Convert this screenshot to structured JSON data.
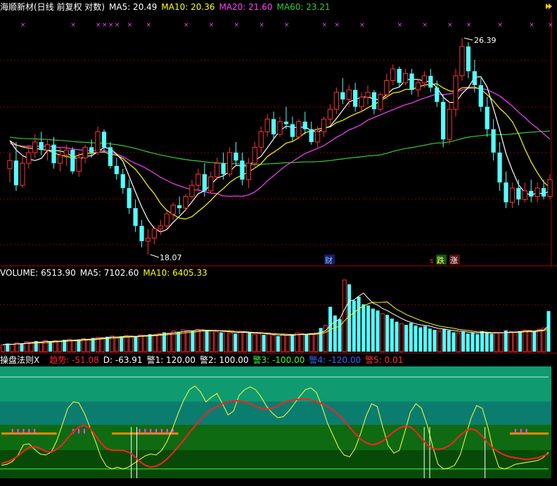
{
  "price_header": {
    "title": "海顺新材(日线 前复权 对数)",
    "ma5": "MA5: 20.49",
    "ma10": "MA10: 20.36",
    "ma20": "MA20: 21.60",
    "ma60": "MA60: 23.21"
  },
  "price_panel": {
    "high_label": "26.39",
    "low_label": "18.07",
    "marker_cai": "财",
    "marker_die": "跌",
    "marker_zhang": "涨",
    "marker_s": "s"
  },
  "vol_header": {
    "title": "VOLUME: 6513.90",
    "ma5": "MA5: 7102.60",
    "ma10": "MA10: 6405.33"
  },
  "ind_header": {
    "title": "操盘法则X",
    "trend": "趋势: -51.08",
    "d": "D: -63.91",
    "warn1": "警1: 120.00",
    "warn2": "警2: 100.00",
    "warn3": "警3: -100.00",
    "warn4": "警4: -120.00",
    "warn5": "警5: 0.01"
  },
  "colors": {
    "up": "#ff3333",
    "down": "#54ffff",
    "ma5": "#ffffff",
    "ma10": "#ffff00",
    "ma20": "#ff40ff",
    "ma60": "#33cc33",
    "trend": "#ff2020",
    "d_line": "#ffff40",
    "grid": "#8b0000"
  },
  "chart_data": [
    {
      "type": "candlestick",
      "title": "海顺新材(日线 前复权 对数)",
      "annotations": [
        {
          "text": "26.39",
          "kind": "high"
        },
        {
          "text": "18.07",
          "kind": "low"
        }
      ],
      "ohlc": [
        [
          21.0,
          21.6,
          20.5,
          21.3
        ],
        [
          21.3,
          22.0,
          20.2,
          20.4
        ],
        [
          20.4,
          21.5,
          20.3,
          21.2
        ],
        [
          21.2,
          21.9,
          21.0,
          21.6
        ],
        [
          21.6,
          22.3,
          21.4,
          22.0
        ],
        [
          22.0,
          22.4,
          21.5,
          21.7
        ],
        [
          21.7,
          22.1,
          21.3,
          21.9
        ],
        [
          21.9,
          22.2,
          21.0,
          21.2
        ],
        [
          21.2,
          21.8,
          20.9,
          21.5
        ],
        [
          21.5,
          21.9,
          21.1,
          21.7
        ],
        [
          21.7,
          21.8,
          20.8,
          20.9
        ],
        [
          20.9,
          21.6,
          20.7,
          21.4
        ],
        [
          21.4,
          21.9,
          21.2,
          21.8
        ],
        [
          21.8,
          22.1,
          21.4,
          21.6
        ],
        [
          21.6,
          22.6,
          21.5,
          22.4
        ],
        [
          22.4,
          22.5,
          21.6,
          21.8
        ],
        [
          21.8,
          22.0,
          21.0,
          21.1
        ],
        [
          21.1,
          21.4,
          20.6,
          20.8
        ],
        [
          20.8,
          21.0,
          20.1,
          20.3
        ],
        [
          20.3,
          20.6,
          19.4,
          19.6
        ],
        [
          19.6,
          19.9,
          18.8,
          19.0
        ],
        [
          19.0,
          19.2,
          18.3,
          18.5
        ],
        [
          18.5,
          18.9,
          18.07,
          18.6
        ],
        [
          18.6,
          19.0,
          18.4,
          18.9
        ],
        [
          18.9,
          19.2,
          18.7,
          19.0
        ],
        [
          19.0,
          19.5,
          18.9,
          19.4
        ],
        [
          19.4,
          19.8,
          19.2,
          19.7
        ],
        [
          19.7,
          20.0,
          19.4,
          19.6
        ],
        [
          19.6,
          20.1,
          19.5,
          20.0
        ],
        [
          20.0,
          20.6,
          19.9,
          20.4
        ],
        [
          20.4,
          21.0,
          20.2,
          20.8
        ],
        [
          20.8,
          21.2,
          20.0,
          20.2
        ],
        [
          20.2,
          20.9,
          20.1,
          20.7
        ],
        [
          20.7,
          21.4,
          20.6,
          21.2
        ],
        [
          21.2,
          21.6,
          20.6,
          20.8
        ],
        [
          20.8,
          21.8,
          20.7,
          21.6
        ],
        [
          21.6,
          22.0,
          21.1,
          21.3
        ],
        [
          21.3,
          21.6,
          20.4,
          20.6
        ],
        [
          20.6,
          21.4,
          20.3,
          21.2
        ],
        [
          21.2,
          22.0,
          21.0,
          21.8
        ],
        [
          21.8,
          22.6,
          21.6,
          22.4
        ],
        [
          22.4,
          23.1,
          22.2,
          22.9
        ],
        [
          22.9,
          23.2,
          22.1,
          22.3
        ],
        [
          22.3,
          23.0,
          22.2,
          22.8
        ],
        [
          22.8,
          23.4,
          22.5,
          22.7
        ],
        [
          22.7,
          23.0,
          22.0,
          22.2
        ],
        [
          22.2,
          22.9,
          22.1,
          22.8
        ],
        [
          22.8,
          23.2,
          22.3,
          22.5
        ],
        [
          22.5,
          22.8,
          21.9,
          22.0
        ],
        [
          22.0,
          22.6,
          21.8,
          22.4
        ],
        [
          22.4,
          23.0,
          22.2,
          22.9
        ],
        [
          22.9,
          23.5,
          22.7,
          23.3
        ],
        [
          23.3,
          24.2,
          23.1,
          24.0
        ],
        [
          24.0,
          24.6,
          23.5,
          23.7
        ],
        [
          23.7,
          24.3,
          23.4,
          24.1
        ],
        [
          24.1,
          24.4,
          23.2,
          23.4
        ],
        [
          23.4,
          24.0,
          23.2,
          23.8
        ],
        [
          23.8,
          24.3,
          23.5,
          24.0
        ],
        [
          24.0,
          24.1,
          23.1,
          23.3
        ],
        [
          23.3,
          24.0,
          23.2,
          23.9
        ],
        [
          23.9,
          24.8,
          23.7,
          24.5
        ],
        [
          24.5,
          25.2,
          24.3,
          25.0
        ],
        [
          25.0,
          25.1,
          24.2,
          24.4
        ],
        [
          24.4,
          25.0,
          24.3,
          24.8
        ],
        [
          24.8,
          25.0,
          23.9,
          24.1
        ],
        [
          24.1,
          24.6,
          23.8,
          24.4
        ],
        [
          24.4,
          24.9,
          24.2,
          24.7
        ],
        [
          24.7,
          25.0,
          24.0,
          24.2
        ],
        [
          24.2,
          24.5,
          23.4,
          23.6
        ],
        [
          23.6,
          23.9,
          21.8,
          22.1
        ],
        [
          22.1,
          23.6,
          21.9,
          23.3
        ],
        [
          23.3,
          25.0,
          23.0,
          24.7
        ],
        [
          24.7,
          26.39,
          24.5,
          26.0
        ],
        [
          26.0,
          26.2,
          24.6,
          24.9
        ],
        [
          24.9,
          25.4,
          24.0,
          24.3
        ],
        [
          24.3,
          24.6,
          23.2,
          23.4
        ],
        [
          23.4,
          23.8,
          22.2,
          22.5
        ],
        [
          22.5,
          22.9,
          21.3,
          21.6
        ],
        [
          21.6,
          22.0,
          20.2,
          20.5
        ],
        [
          20.5,
          20.9,
          19.6,
          19.8
        ],
        [
          19.8,
          20.5,
          19.6,
          20.3
        ],
        [
          20.3,
          20.6,
          19.7,
          19.9
        ],
        [
          19.9,
          20.5,
          19.8,
          20.2
        ],
        [
          20.2,
          20.6,
          19.8,
          20.0
        ],
        [
          20.0,
          20.5,
          19.8,
          20.3
        ],
        [
          20.3,
          20.6,
          19.9,
          20.0
        ],
        [
          20.0,
          20.8,
          19.9,
          20.6
        ]
      ],
      "ma_values": {
        "MA5": 20.49,
        "MA10": 20.36,
        "MA20": 21.6,
        "MA60": 23.21
      }
    },
    {
      "type": "bar",
      "title": "VOLUME",
      "values": [
        1100,
        1300,
        1150,
        1400,
        1350,
        1600,
        1550,
        1700,
        1500,
        1800,
        1650,
        1750,
        1700,
        1900,
        2000,
        1850,
        1950,
        2100,
        2000,
        2200,
        2300,
        2250,
        2400,
        2500,
        2350,
        2450,
        2600,
        2500,
        2400,
        2700,
        2600,
        2800,
        2750,
        2900,
        3100,
        3000,
        3300,
        3200,
        3500,
        3400,
        3300,
        3600,
        3500,
        3400,
        3300,
        3200,
        3100,
        3300,
        3000,
        2900,
        3100,
        3200,
        3000,
        2800,
        2900,
        2700,
        2800,
        2600,
        2500,
        2700,
        2600,
        2800,
        3000,
        2900,
        2800,
        2900,
        3000,
        3800,
        4200,
        7200,
        5800,
        5200,
        11500,
        10800,
        8200,
        8800,
        7600,
        7400,
        6900,
        6600,
        6100,
        5900,
        5300,
        4800,
        4500,
        4300,
        4600,
        4200,
        3900,
        4100,
        3700,
        3500,
        3300,
        3600,
        3400,
        3100,
        3000,
        3200,
        2900,
        3100,
        2800,
        3300,
        3000,
        2900,
        3100,
        3000,
        3400,
        3200,
        3100,
        3300,
        3500,
        3400,
        3200,
        3600,
        3800,
        6513.9
      ],
      "ma5": 7102.6,
      "ma10": 6405.33
    },
    {
      "type": "line",
      "title": "操盘法则X",
      "series": [
        {
          "name": "趋势",
          "values": [
            -88,
            -85,
            -80,
            -72,
            -62,
            -54,
            -52,
            -56,
            -62,
            -64,
            -58,
            -48,
            -34,
            -20,
            -10,
            -6,
            -12,
            -28,
            -44,
            -56,
            -60,
            -60,
            -60,
            -64,
            -72,
            -84,
            -92,
            -96,
            -94,
            -88,
            -78,
            -66,
            -52,
            -38,
            -22,
            -8,
            6,
            18,
            28,
            34,
            40,
            44,
            46,
            46,
            44,
            40,
            34,
            30,
            28,
            30,
            36,
            42,
            46,
            48,
            50,
            50,
            48,
            44,
            40,
            34,
            26,
            16,
            4,
            -10,
            -24,
            -36,
            -44,
            -48,
            -46,
            -40,
            -30,
            -20,
            -12,
            -8,
            -10,
            -20,
            -34,
            -48,
            -56,
            -58,
            -56,
            -50,
            -40,
            -28,
            -18,
            -14,
            -18,
            -30,
            -44,
            -56,
            -64,
            -70,
            -74,
            -76,
            -78,
            -80,
            -78,
            -76,
            -72,
            -68
          ]
        },
        {
          "name": "D",
          "values": [
            -92,
            -90,
            -84,
            -70,
            -48,
            -46,
            -58,
            -68,
            -70,
            -64,
            -40,
            -6,
            30,
            44,
            42,
            20,
            -10,
            -40,
            -74,
            -94,
            -100,
            -96,
            -100,
            -96,
            -88,
            -80,
            -72,
            -68,
            -70,
            -60,
            -40,
            -12,
            20,
            48,
            70,
            78,
            66,
            44,
            54,
            62,
            40,
            16,
            24,
            58,
            70,
            76,
            70,
            54,
            34,
            20,
            10,
            12,
            24,
            40,
            56,
            70,
            74,
            64,
            34,
            -2,
            -28,
            -54,
            -70,
            -74,
            -56,
            -24,
            14,
            40,
            34,
            -10,
            -50,
            -66,
            -60,
            -20,
            22,
            40,
            30,
            -4,
            -50,
            -90,
            -100,
            -98,
            -92,
            -70,
            -30,
            10,
            36,
            30,
            -10,
            -60,
            -96,
            -100,
            -96,
            -90,
            -88,
            -86,
            -84,
            -82,
            -76,
            -64
          ]
        }
      ],
      "levels": {
        "警1": 120,
        "警2": 100,
        "警3": -100,
        "警4": -120,
        "警5": 0.01
      },
      "latest": {
        "趋势": -51.08,
        "D": -63.91
      }
    }
  ]
}
